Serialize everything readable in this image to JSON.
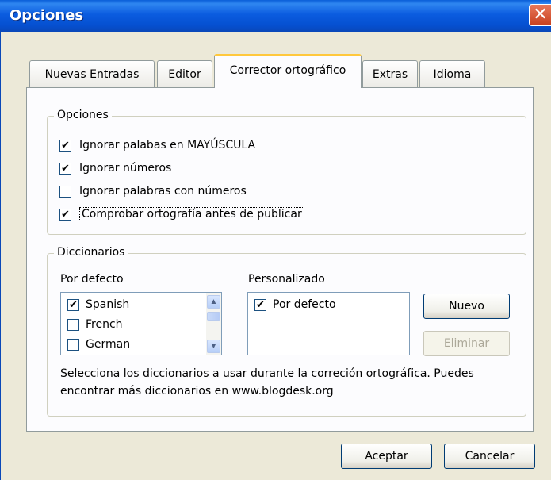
{
  "window": {
    "title": "Opciones",
    "close_glyph": "✕"
  },
  "tabs": [
    {
      "label": "Nuevas Entradas",
      "active": false
    },
    {
      "label": "Editor",
      "active": false
    },
    {
      "label": "Corrector ortográfico",
      "active": true
    },
    {
      "label": "Extras",
      "active": false
    },
    {
      "label": "Idioma",
      "active": false
    }
  ],
  "options_group": {
    "label": "Opciones",
    "items": [
      {
        "label": "Ignorar palabas en MAYÚSCULA",
        "checked": true
      },
      {
        "label": "Ignorar números",
        "checked": true
      },
      {
        "label": "Ignorar palabras con números",
        "checked": false
      },
      {
        "label": "Comprobar ortografía antes de publicar",
        "checked": true
      }
    ]
  },
  "dictionaries_group": {
    "label": "Diccionarios",
    "default_label": "Por defecto",
    "custom_label": "Personalizado",
    "default_list": [
      {
        "label": "Spanish",
        "checked": true
      },
      {
        "label": "French",
        "checked": false
      },
      {
        "label": "German",
        "checked": false
      }
    ],
    "custom_list": [
      {
        "label": "Por defecto",
        "checked": true
      }
    ],
    "new_button": "Nuevo",
    "delete_button": "Eliminar",
    "description": "Selecciona los diccionarios a usar durante la correción ortográfica. Puedes encontrar más diccionarios en www.blogdesk.org"
  },
  "footer": {
    "accept_button": "Aceptar",
    "cancel_button": "Cancelar"
  },
  "colors": {
    "titlebar": "#0550d0",
    "face": "#ece9d8",
    "tab_highlight": "#ffc83c"
  },
  "check_glyph": "✔"
}
